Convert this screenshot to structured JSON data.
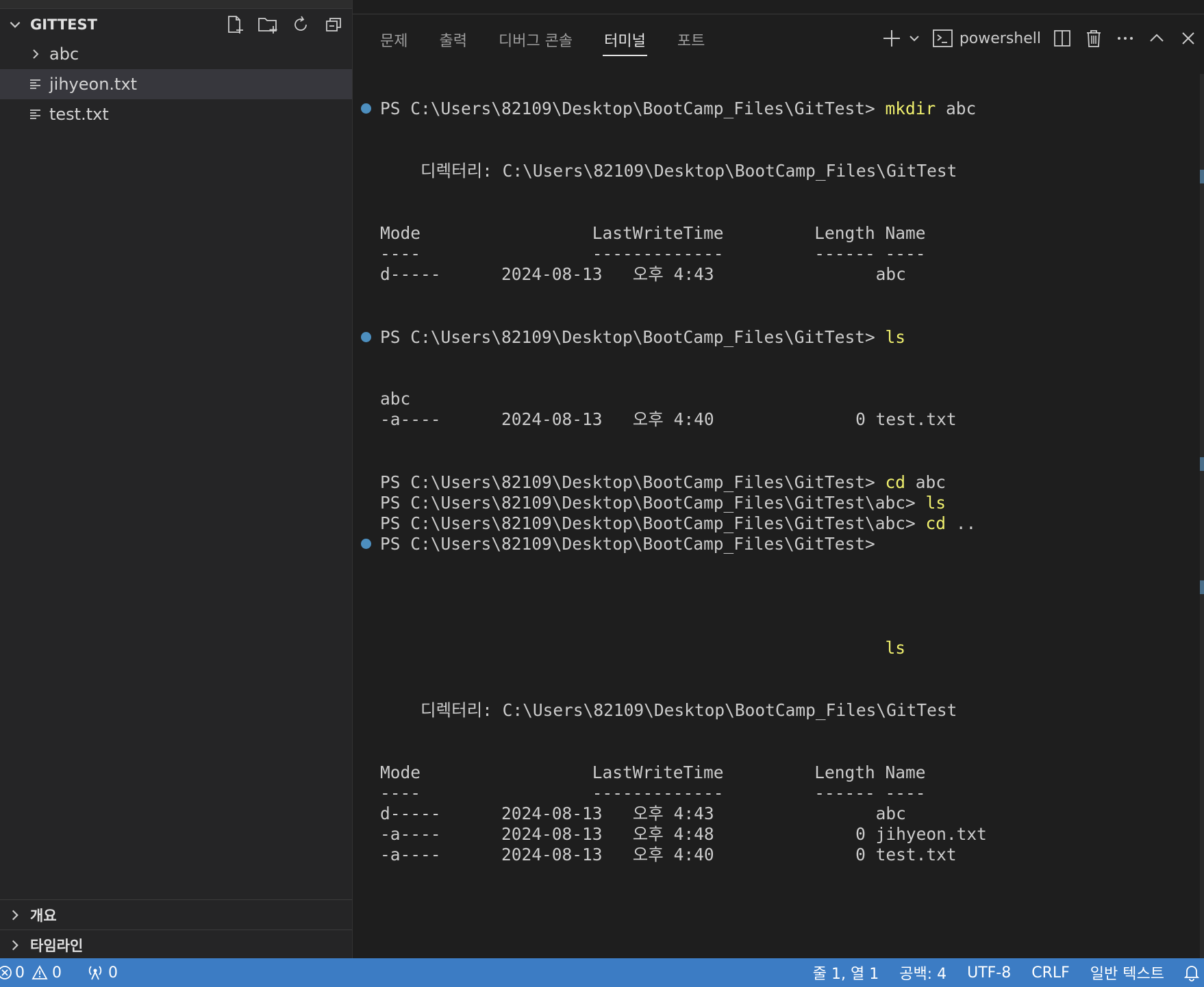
{
  "explorer": {
    "section_title": "GITTEST",
    "actions": [
      "new-file-icon",
      "new-folder-icon",
      "refresh-icon",
      "collapse-all-icon"
    ],
    "items": [
      {
        "label": "abc",
        "type": "folder"
      },
      {
        "label": "jihyeon.txt",
        "type": "file",
        "selected": true
      },
      {
        "label": "test.txt",
        "type": "file"
      }
    ],
    "bottom_sections": [
      {
        "label": "개요"
      },
      {
        "label": "타임라인"
      }
    ]
  },
  "panel": {
    "tabs": [
      {
        "label": "문제"
      },
      {
        "label": "출력"
      },
      {
        "label": "디버그 콘솔"
      },
      {
        "label": "터미널",
        "active": true
      },
      {
        "label": "포트"
      }
    ],
    "shell_label": "powershell"
  },
  "terminal": {
    "lines": [
      {
        "t": "PS C:\\Users\\82109\\Desktop\\BootCamp_Files\\GitTest> ",
        "cmd": "mkdir",
        "arg": " abc",
        "dot": true
      },
      {
        "t": "    디렉터리: C:\\Users\\82109\\Desktop\\BootCamp_Files\\GitTest"
      },
      {
        "t": "Mode                 LastWriteTime         Length Name"
      },
      {
        "t": "----                 -------------         ------ ----"
      },
      {
        "t": "d-----      2024-08-13   오후 4:43                abc"
      },
      {
        "t": "PS C:\\Users\\82109\\Desktop\\BootCamp_Files\\GitTest> ",
        "cmd": "ls",
        "arg": "",
        "dot": true
      },
      {
        "t": "abc"
      },
      {
        "t": "-a----      2024-08-13   오후 4:40              0 test.txt"
      },
      {
        "t": "PS C:\\Users\\82109\\Desktop\\BootCamp_Files\\GitTest> ",
        "cmd": "cd",
        "arg": " abc"
      },
      {
        "t": "PS C:\\Users\\82109\\Desktop\\BootCamp_Files\\GitTest\\abc> ",
        "cmd": "ls",
        "arg": ""
      },
      {
        "t": "PS C:\\Users\\82109\\Desktop\\BootCamp_Files\\GitTest\\abc> ",
        "cmd": "cd",
        "arg": " .."
      },
      {
        "t": "PS C:\\Users\\82109\\Desktop\\BootCamp_Files\\GitTest>",
        "dot": true
      },
      {
        "t": "                                                  ",
        "cmd": "ls",
        "arg": ""
      },
      {
        "t": "    디렉터리: C:\\Users\\82109\\Desktop\\BootCamp_Files\\GitTest"
      },
      {
        "t": "Mode                 LastWriteTime         Length Name"
      },
      {
        "t": "----                 -------------         ------ ----"
      },
      {
        "t": "d-----      2024-08-13   오후 4:43                abc"
      },
      {
        "t": "-a----      2024-08-13   오후 4:48              0 jihyeon.txt"
      },
      {
        "t": "-a----      2024-08-13   오후 4:40              0 test.txt"
      }
    ]
  },
  "statusbar": {
    "errors": "0",
    "warnings": "0",
    "ports": "0",
    "position": "줄 1, 열 1",
    "spaces": "공백: 4",
    "encoding": "UTF-8",
    "eol": "CRLF",
    "language": "일반 텍스트"
  },
  "colors": {
    "accent": "#3c7cc4",
    "command": "#f0f06e",
    "prompt_dot": "#4d8fbf"
  }
}
